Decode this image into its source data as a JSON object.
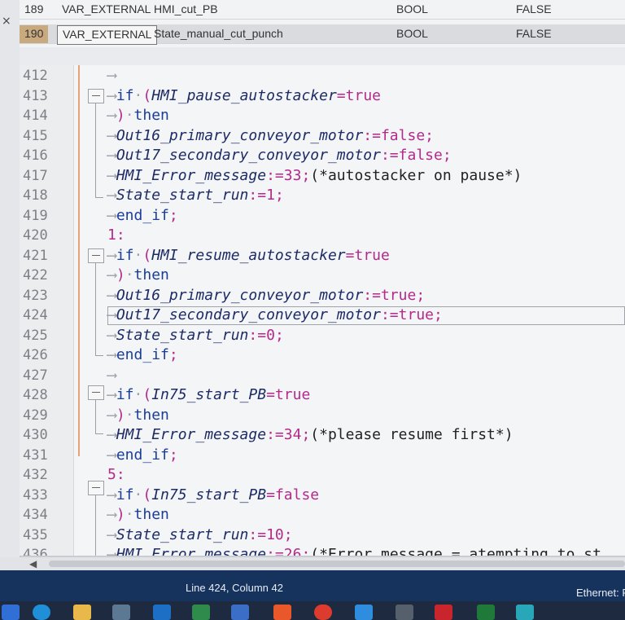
{
  "variables": [
    {
      "num": "189",
      "class": "VAR_EXTERNAL",
      "name": "HMI_cut_PB",
      "type": "BOOL",
      "init": "FALSE"
    },
    {
      "num": "190",
      "class": "VAR_EXTERNAL",
      "name": "State_manual_cut_punch",
      "type": "BOOL",
      "init": "FALSE"
    }
  ],
  "editor": {
    "line_numbers": [
      "412",
      "413",
      "414",
      "415",
      "416",
      "417",
      "418",
      "419",
      "420",
      "421",
      "422",
      "423",
      "424",
      "425",
      "426",
      "427",
      "428",
      "429",
      "430",
      "431",
      "432",
      "433",
      "434",
      "435",
      "436"
    ],
    "lines": {
      "l413_kw": "if",
      "l413_id": "HMI_pause_autostacker",
      "l413_val": "true",
      "l414_kw": "then",
      "l415_id": "Out16_primary_conveyor_motor",
      "l415_val": "false",
      "l416_id": "Out17_secondary_conveyor_motor",
      "l416_val": "false",
      "l417_id": "HMI_Error_message",
      "l417_num": "33",
      "l417_cm": "(*autostacker on pause*)",
      "l418_id": "State_start_run",
      "l418_num": "1",
      "l419_kw": "end_if",
      "l420_case": "1:",
      "l421_kw": "if",
      "l421_id": "HMI_resume_autostacker",
      "l421_val": "true",
      "l422_kw": "then",
      "l423_id": "Out16_primary_conveyor_motor",
      "l423_val": "true",
      "l424_id": "Out17_secondary_conveyor_motor",
      "l424_val": "true",
      "l425_id": "State_start_run",
      "l425_num": "0",
      "l426_kw": "end_if",
      "l428_kw": "if",
      "l428_id": "In75_start_PB",
      "l428_val": "true",
      "l429_kw": "then",
      "l430_id": "HMI_Error_message",
      "l430_num": "34",
      "l430_cm": "(*please resume first*)",
      "l431_kw": "end_if",
      "l432_case": "5:",
      "l433_kw": "if",
      "l433_id": "In75_start_PB",
      "l433_val": "false",
      "l434_kw": "then",
      "l435_id": "State_start_run",
      "l435_num": "10",
      "l436_id": "HMI_Error_message",
      "l436_num": "26",
      "l436_cm": "(*Error message = atempting to st"
    }
  },
  "status": {
    "position": "Line 424, Column 42",
    "network": "Ethernet: F"
  },
  "close_glyph": "×",
  "scroll_left_glyph": "◀",
  "colors": {
    "statusbar": "#16335e",
    "keyword": "#1a3d9c",
    "literal": "#b3298c",
    "selected_cell": "#c9a97e"
  }
}
